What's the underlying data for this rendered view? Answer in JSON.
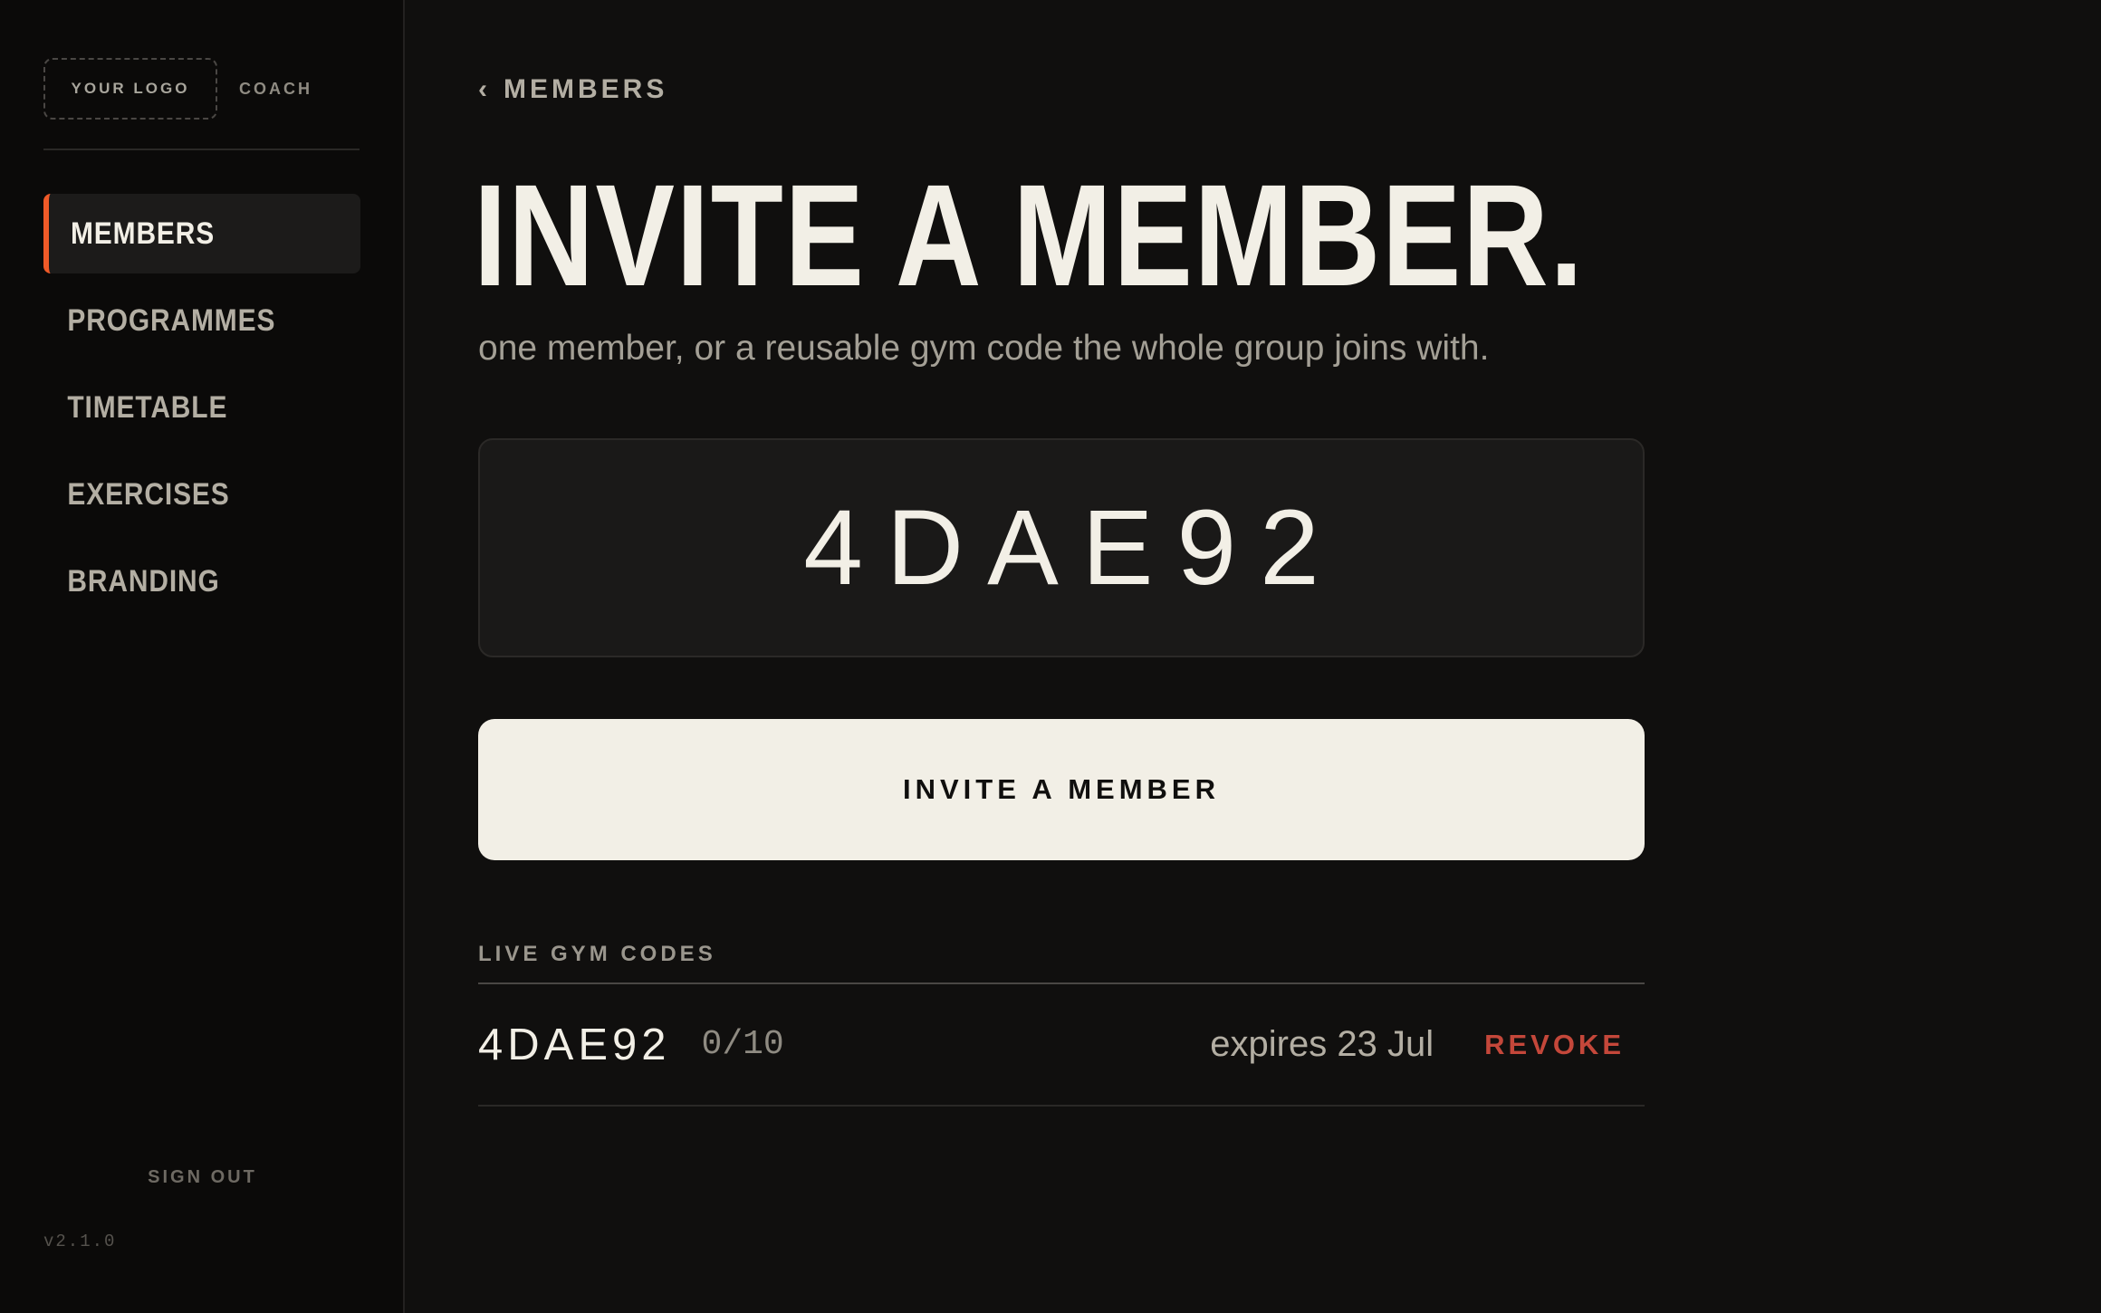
{
  "sidebar": {
    "logo_label": "YOUR LOGO",
    "role_label": "COACH",
    "items": [
      {
        "label": "MEMBERS",
        "active": true
      },
      {
        "label": "PROGRAMMES"
      },
      {
        "label": "TIMETABLE"
      },
      {
        "label": "EXERCISES"
      },
      {
        "label": "BRANDING"
      }
    ],
    "sign_out": "SIGN OUT",
    "version": "v2.1.0"
  },
  "main": {
    "back_label": "MEMBERS",
    "title": "INVITE A MEMBER.",
    "subtitle": "one member, or a reusable gym code the whole group joins with.",
    "code": "4DAE92",
    "invite_button": "INVITE A MEMBER",
    "live_codes": {
      "heading": "LIVE GYM CODES",
      "rows": [
        {
          "code": "4DAE92",
          "usage": "0/10",
          "expires": "expires 23 Jul",
          "action": "REVOKE"
        }
      ]
    }
  },
  "colors": {
    "accent": "#f05a28",
    "danger": "#c4473a",
    "background": "#100f0e",
    "text": "#f2efe6"
  }
}
